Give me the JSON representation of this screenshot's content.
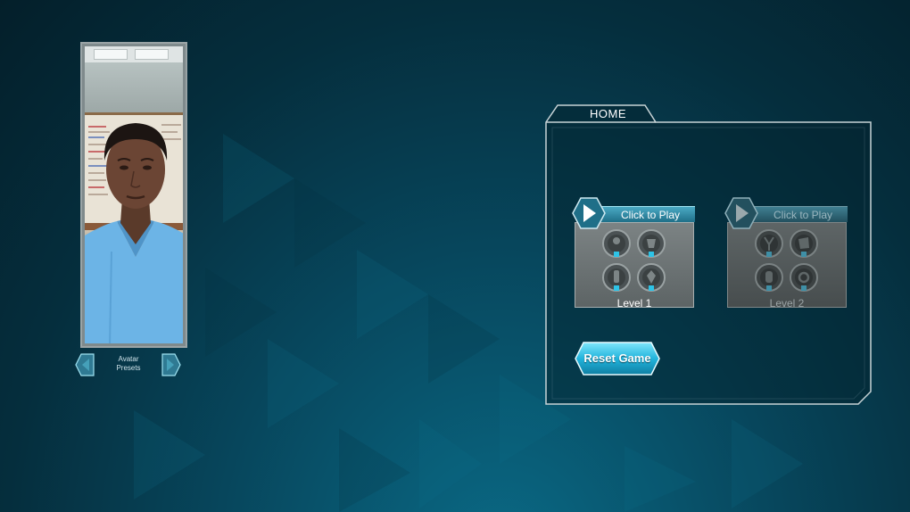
{
  "avatar": {
    "label_line1": "Avatar",
    "label_line2": "Presets"
  },
  "home": {
    "title": "HOME",
    "reset_label": "Reset Game",
    "levels": [
      {
        "play_label": "Click to Play",
        "name": "Level 1",
        "enabled": true
      },
      {
        "play_label": "Click to Play",
        "name": "Level 2",
        "enabled": false
      }
    ]
  },
  "colors": {
    "accent": "#2ec3e6",
    "panel_border": "#c7d3d6",
    "background": "#063c50"
  }
}
